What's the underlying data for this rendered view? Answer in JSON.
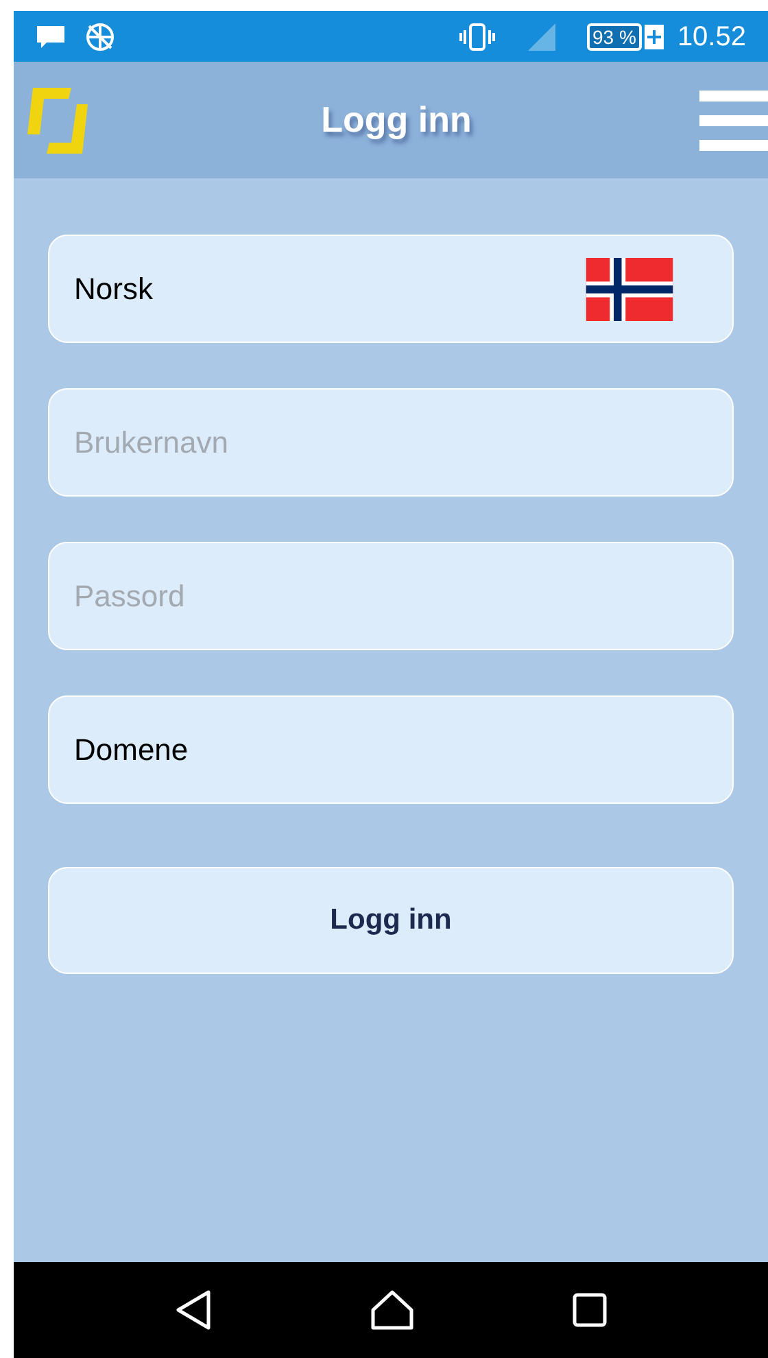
{
  "status_bar": {
    "battery": "93 %",
    "time": "10.52"
  },
  "app_bar": {
    "title": "Logg inn"
  },
  "form": {
    "language": {
      "value": "Norsk"
    },
    "fields": [
      {
        "placeholder": "Brukernavn"
      },
      {
        "placeholder": "Passord"
      },
      {
        "value": "Domene"
      }
    ],
    "submit": "Logg inn"
  }
}
